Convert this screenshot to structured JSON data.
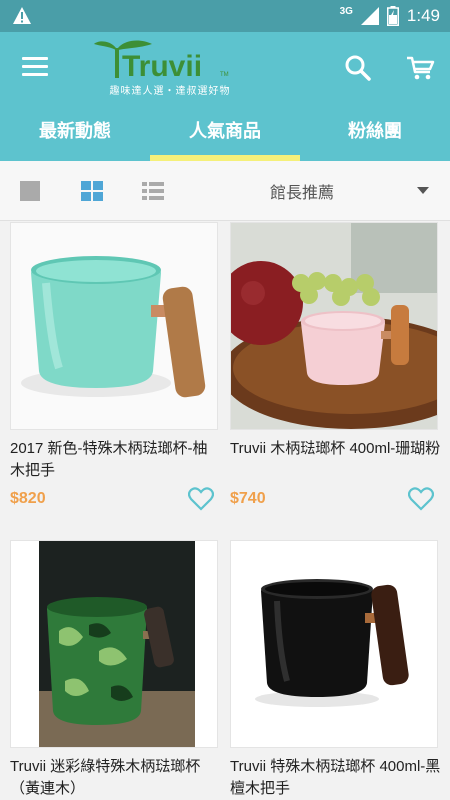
{
  "status_bar": {
    "network": "3G",
    "time": "1:49"
  },
  "header": {
    "logo_text": "Truvii",
    "logo_tm": "TM",
    "slogan": "趣味達人選・達叔選好物"
  },
  "tabs": [
    {
      "label": "最新動態",
      "active": false
    },
    {
      "label": "人氣商品",
      "active": true
    },
    {
      "label": "粉絲團",
      "active": false
    }
  ],
  "toolbar": {
    "sort_label": "館長推薦"
  },
  "colors": {
    "header": "#5dc3ce",
    "status": "#4a9ea8",
    "tab_indicator": "#f5f07a",
    "price": "#f0a04b",
    "heart": "#5dc3ce"
  },
  "products": [
    {
      "name": "2017 新色-特殊木柄琺瑯杯-柚木把手",
      "price": "$820"
    },
    {
      "name": "Truvii 木柄琺瑯杯 400ml-珊瑚粉",
      "price": "$740"
    },
    {
      "name": "Truvii 迷彩綠特殊木柄琺瑯杯（黃連木）",
      "price": ""
    },
    {
      "name": "Truvii 特殊木柄琺瑯杯 400ml-黑檀木把手",
      "price": ""
    }
  ]
}
